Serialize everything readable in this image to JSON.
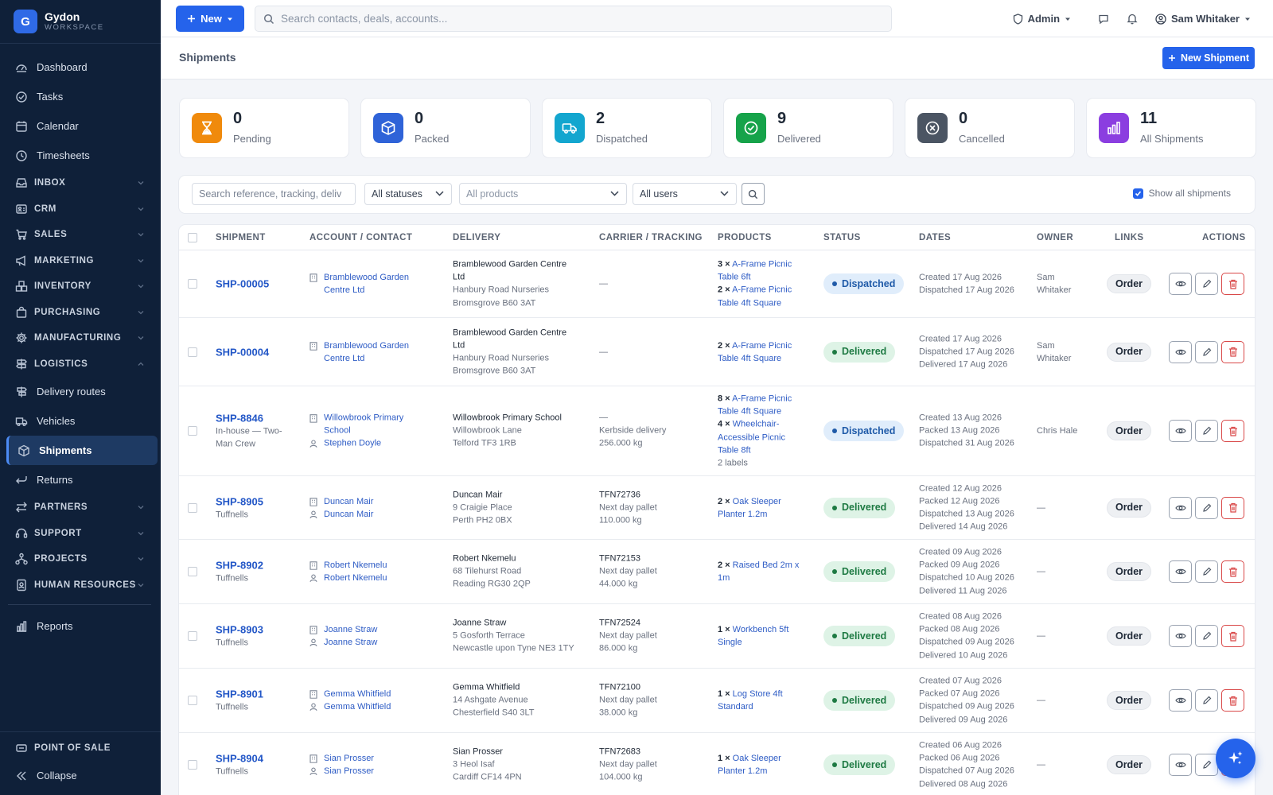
{
  "brand": {
    "name": "Gydon",
    "sub": "WORKSPACE",
    "logo_letter": "G"
  },
  "sidebar": {
    "items": [
      {
        "label": "Dashboard",
        "icon": "dashboard-icon",
        "kind": "item"
      },
      {
        "label": "Tasks",
        "icon": "check-circle-icon",
        "kind": "item"
      },
      {
        "label": "Calendar",
        "icon": "calendar-icon",
        "kind": "item"
      },
      {
        "label": "Timesheets",
        "icon": "clock-icon",
        "kind": "item"
      },
      {
        "label": "INBOX",
        "icon": "inbox-icon",
        "kind": "section",
        "expanded": false
      },
      {
        "label": "CRM",
        "icon": "contact-card-icon",
        "kind": "section",
        "expanded": false
      },
      {
        "label": "SALES",
        "icon": "cart-icon",
        "kind": "section",
        "expanded": false
      },
      {
        "label": "MARKETING",
        "icon": "megaphone-icon",
        "kind": "section",
        "expanded": false
      },
      {
        "label": "INVENTORY",
        "icon": "boxes-icon",
        "kind": "section",
        "expanded": false
      },
      {
        "label": "PURCHASING",
        "icon": "bag-icon",
        "kind": "section",
        "expanded": false
      },
      {
        "label": "MANUFACTURING",
        "icon": "gear-icon",
        "kind": "section",
        "expanded": false
      },
      {
        "label": "LOGISTICS",
        "icon": "signpost-icon",
        "kind": "section",
        "expanded": true
      },
      {
        "label": "Delivery routes",
        "icon": "route-icon",
        "kind": "sub"
      },
      {
        "label": "Vehicles",
        "icon": "truck-icon",
        "kind": "sub"
      },
      {
        "label": "Shipments",
        "icon": "package-icon",
        "kind": "sub",
        "active": true
      },
      {
        "label": "Returns",
        "icon": "return-arrow-icon",
        "kind": "sub"
      },
      {
        "label": "PARTNERS",
        "icon": "swap-icon",
        "kind": "section",
        "expanded": false
      },
      {
        "label": "SUPPORT",
        "icon": "headset-icon",
        "kind": "section",
        "expanded": false
      },
      {
        "label": "PROJECTS",
        "icon": "network-icon",
        "kind": "section",
        "expanded": false
      },
      {
        "label": "HUMAN RESOURCES",
        "icon": "badge-icon",
        "kind": "section",
        "expanded": false
      },
      {
        "label": "Reports",
        "icon": "bar-chart-icon",
        "kind": "item",
        "divider_before": true
      }
    ],
    "pos_label": "POINT OF SALE",
    "collapse_label": "Collapse"
  },
  "topbar": {
    "new_label": "New",
    "search_placeholder": "Search contacts, deals, accounts...",
    "role_label": "Admin",
    "user_name": "Sam Whitaker"
  },
  "page": {
    "title": "Shipments",
    "new_button": "New Shipment"
  },
  "stats": [
    {
      "value": "0",
      "label": "Pending",
      "color": "#f08a0c",
      "icon": "hourglass-icon"
    },
    {
      "value": "0",
      "label": "Packed",
      "color": "#2f63d8",
      "icon": "box-icon"
    },
    {
      "value": "2",
      "label": "Dispatched",
      "color": "#13a6cf",
      "icon": "truck-icon"
    },
    {
      "value": "9",
      "label": "Delivered",
      "color": "#16a34a",
      "icon": "check-circle-icon"
    },
    {
      "value": "0",
      "label": "Cancelled",
      "color": "#4b5563",
      "icon": "x-circle-icon"
    },
    {
      "value": "11",
      "label": "All Shipments",
      "color": "#8b3ee0",
      "icon": "bar-chart-icon"
    }
  ],
  "filters": {
    "search_placeholder": "Search reference, tracking, deliv",
    "status_value": "All statuses",
    "product_placeholder": "All products",
    "user_value": "All users",
    "show_all_label": "Show all shipments",
    "show_all_checked": true
  },
  "table": {
    "columns": [
      "SHIPMENT",
      "ACCOUNT / CONTACT",
      "DELIVERY",
      "CARRIER / TRACKING",
      "PRODUCTS",
      "STATUS",
      "DATES",
      "OWNER",
      "LINKS",
      "ACTIONS"
    ],
    "rows": [
      {
        "id": "SHP-00005",
        "sub": [],
        "account": [
          "Bramblewood Garden",
          "Centre Ltd"
        ],
        "contact": [],
        "delivery": {
          "name": [
            "Bramblewood Garden Centre",
            "Ltd"
          ],
          "address": [
            "Hanbury Road Nurseries",
            "Bromsgrove B60 3AT"
          ]
        },
        "carrier": [
          "—"
        ],
        "products": [
          {
            "qty": "3 ×",
            "lines": [
              "A-Frame Picnic",
              "Table 6ft"
            ]
          },
          {
            "qty": "2 ×",
            "lines": [
              "A-Frame Picnic",
              "Table 4ft Square"
            ]
          }
        ],
        "products_note": "",
        "status": "Dispatched",
        "status_kind": "dispatched",
        "dates": [
          "Created 17 Aug 2026",
          "Dispatched 17 Aug 2026"
        ],
        "owner": [
          "Sam",
          "Whitaker"
        ],
        "link": "Order",
        "height": 85
      },
      {
        "id": "SHP-00004",
        "sub": [],
        "account": [
          "Bramblewood Garden",
          "Centre Ltd"
        ],
        "contact": [],
        "delivery": {
          "name": [
            "Bramblewood Garden Centre",
            "Ltd"
          ],
          "address": [
            "Hanbury Road Nurseries",
            "Bromsgrove B60 3AT"
          ]
        },
        "carrier": [
          "—"
        ],
        "products": [
          {
            "qty": "2 ×",
            "lines": [
              "A-Frame Picnic",
              "Table 4ft Square"
            ]
          }
        ],
        "products_note": "",
        "status": "Delivered",
        "status_kind": "delivered",
        "dates": [
          "Created 17 Aug 2026",
          "Dispatched 17 Aug 2026",
          "Delivered 17 Aug 2026"
        ],
        "owner": [
          "Sam",
          "Whitaker"
        ],
        "link": "Order",
        "height": 86
      },
      {
        "id": "SHP-8846",
        "sub": [
          "In-house — Two-",
          "Man Crew"
        ],
        "account": [
          "Willowbrook Primary",
          "School"
        ],
        "contact": [
          "Stephen Doyle"
        ],
        "delivery": {
          "name": [
            "Willowbrook Primary School"
          ],
          "address": [
            "Willowbrook Lane",
            "Telford TF3 1RB"
          ]
        },
        "carrier": [
          "—",
          "Kerbside delivery",
          "256.000 kg"
        ],
        "products": [
          {
            "qty": "8 ×",
            "lines": [
              "A-Frame Picnic",
              "Table 4ft Square"
            ]
          },
          {
            "qty": "4 ×",
            "lines": [
              "Wheelchair-",
              "Accessible Picnic",
              "Table 8ft"
            ]
          }
        ],
        "products_note": "2 labels",
        "status": "Dispatched",
        "status_kind": "dispatched",
        "dates": [
          "Created 13 Aug 2026",
          "Packed 13 Aug 2026",
          "Dispatched 31 Aug 2026"
        ],
        "owner": [
          "Chris Hale"
        ],
        "link": "Order",
        "height": 113
      },
      {
        "id": "SHP-8905",
        "sub": [
          "Tuffnells"
        ],
        "account": [
          "Duncan Mair"
        ],
        "contact": [
          "Duncan Mair"
        ],
        "delivery": {
          "name": [
            "Duncan Mair"
          ],
          "address": [
            "9 Craigie Place",
            "Perth PH2 0BX"
          ]
        },
        "carrier": [
          "TFN72736",
          "Next day pallet",
          "110.000 kg"
        ],
        "products": [
          {
            "qty": "2 ×",
            "lines": [
              "Oak Sleeper",
              "Planter 1.2m"
            ]
          }
        ],
        "products_note": "",
        "status": "Delivered",
        "status_kind": "delivered",
        "dates": [
          "Created 12 Aug 2026",
          "Packed 12 Aug 2026",
          "Dispatched 13 Aug 2026",
          "Delivered 14 Aug 2026"
        ],
        "owner": [
          "—"
        ],
        "link": "Order",
        "height": 80
      },
      {
        "id": "SHP-8902",
        "sub": [
          "Tuffnells"
        ],
        "account": [
          "Robert Nkemelu"
        ],
        "contact": [
          "Robert Nkemelu"
        ],
        "delivery": {
          "name": [
            "Robert Nkemelu"
          ],
          "address": [
            "68 Tilehurst Road",
            "Reading RG30 2QP"
          ]
        },
        "carrier": [
          "TFN72153",
          "Next day pallet",
          "44.000 kg"
        ],
        "products": [
          {
            "qty": "2 ×",
            "lines": [
              "Raised Bed 2m x",
              "1m"
            ]
          }
        ],
        "products_note": "",
        "status": "Delivered",
        "status_kind": "delivered",
        "dates": [
          "Created 09 Aug 2026",
          "Packed 09 Aug 2026",
          "Dispatched 10 Aug 2026",
          "Delivered 11 Aug 2026"
        ],
        "owner": [
          "—"
        ],
        "link": "Order",
        "height": 81
      },
      {
        "id": "SHP-8903",
        "sub": [
          "Tuffnells"
        ],
        "account": [
          "Joanne Straw"
        ],
        "contact": [
          "Joanne Straw"
        ],
        "delivery": {
          "name": [
            "Joanne Straw"
          ],
          "address": [
            "5 Gosforth Terrace",
            "Newcastle upon Tyne NE3 1TY"
          ]
        },
        "carrier": [
          "TFN72524",
          "Next day pallet",
          "86.000 kg"
        ],
        "products": [
          {
            "qty": "1 ×",
            "lines": [
              "Workbench 5ft",
              "Single"
            ]
          }
        ],
        "products_note": "",
        "status": "Delivered",
        "status_kind": "delivered",
        "dates": [
          "Created 08 Aug 2026",
          "Packed 08 Aug 2026",
          "Dispatched 09 Aug 2026",
          "Delivered 10 Aug 2026"
        ],
        "owner": [
          "—"
        ],
        "link": "Order",
        "height": 81
      },
      {
        "id": "SHP-8901",
        "sub": [
          "Tuffnells"
        ],
        "account": [
          "Gemma Whitfield"
        ],
        "contact": [
          "Gemma Whitfield"
        ],
        "delivery": {
          "name": [
            "Gemma Whitfield"
          ],
          "address": [
            "14 Ashgate Avenue",
            "Chesterfield S40 3LT"
          ]
        },
        "carrier": [
          "TFN72100",
          "Next day pallet",
          "38.000 kg"
        ],
        "products": [
          {
            "qty": "1 ×",
            "lines": [
              "Log Store 4ft",
              "Standard"
            ]
          }
        ],
        "products_note": "",
        "status": "Delivered",
        "status_kind": "delivered",
        "dates": [
          "Created 07 Aug 2026",
          "Packed 07 Aug 2026",
          "Dispatched 09 Aug 2026",
          "Delivered 09 Aug 2026"
        ],
        "owner": [
          "—"
        ],
        "link": "Order",
        "height": 81
      },
      {
        "id": "SHP-8904",
        "sub": [
          "Tuffnells"
        ],
        "account": [
          "Sian Prosser"
        ],
        "contact": [
          "Sian Prosser"
        ],
        "delivery": {
          "name": [
            "Sian Prosser"
          ],
          "address": [
            "3 Heol Isaf",
            "Cardiff CF14 4PN"
          ]
        },
        "carrier": [
          "TFN72683",
          "Next day pallet",
          "104.000 kg"
        ],
        "products": [
          {
            "qty": "1 ×",
            "lines": [
              "Oak Sleeper",
              "Planter 1.2m"
            ]
          }
        ],
        "products_note": "",
        "status": "Delivered",
        "status_kind": "delivered",
        "dates": [
          "Created 06 Aug 2026",
          "Packed 06 Aug 2026",
          "Dispatched 07 Aug 2026",
          "Delivered 08 Aug 2026"
        ],
        "owner": [
          "—"
        ],
        "link": "Order",
        "height": 81
      }
    ]
  }
}
